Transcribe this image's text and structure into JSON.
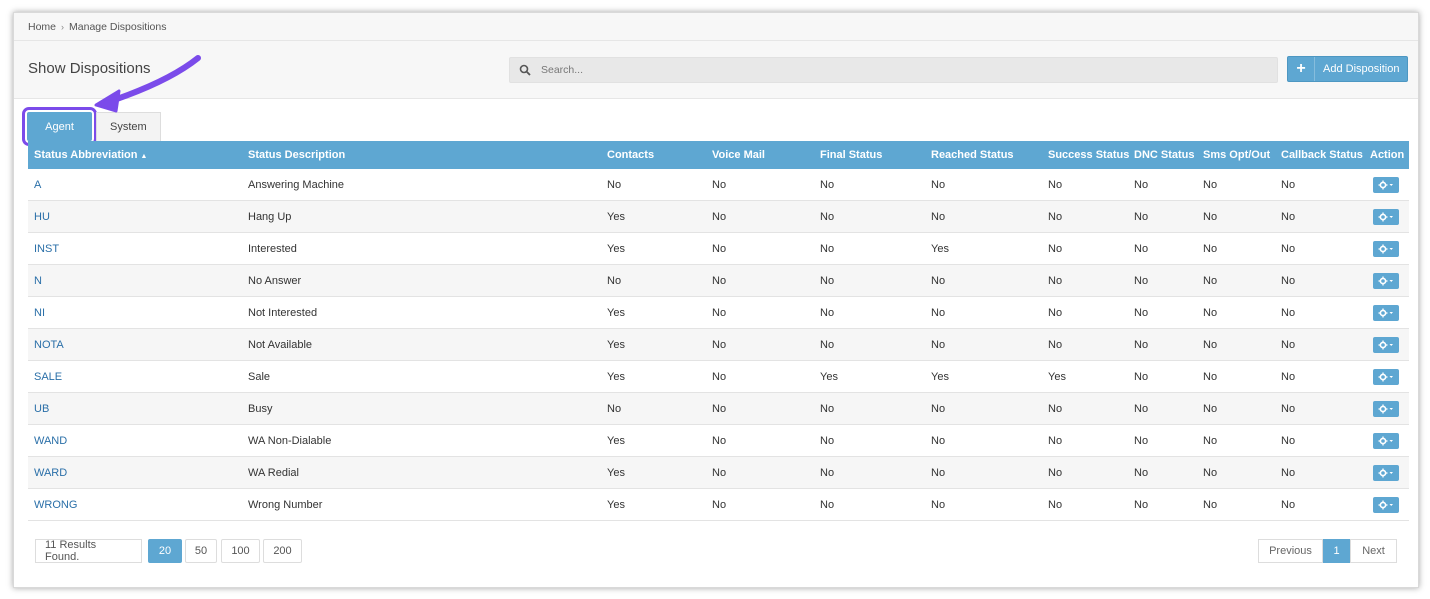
{
  "breadcrumb": {
    "home": "Home",
    "current": "Manage Dispositions"
  },
  "header": {
    "title": "Show Dispositions",
    "search_placeholder": "Search...",
    "add_button": "Add Disposition"
  },
  "tabs": [
    {
      "label": "Agent"
    },
    {
      "label": "System"
    }
  ],
  "table": {
    "headers": [
      "Status Abbreviation",
      "Status Description",
      "Contacts",
      "Voice Mail",
      "Final Status",
      "Reached Status",
      "Success Status",
      "DNC Status",
      "Sms Opt/Out",
      "Callback Status",
      "Action"
    ],
    "rows": [
      [
        "A",
        "Answering Machine",
        "No",
        "No",
        "No",
        "No",
        "No",
        "No",
        "No",
        "No"
      ],
      [
        "HU",
        "Hang Up",
        "Yes",
        "No",
        "No",
        "No",
        "No",
        "No",
        "No",
        "No"
      ],
      [
        "INST",
        "Interested",
        "Yes",
        "No",
        "No",
        "Yes",
        "No",
        "No",
        "No",
        "No"
      ],
      [
        "N",
        "No Answer",
        "No",
        "No",
        "No",
        "No",
        "No",
        "No",
        "No",
        "No"
      ],
      [
        "NI",
        "Not Interested",
        "Yes",
        "No",
        "No",
        "No",
        "No",
        "No",
        "No",
        "No"
      ],
      [
        "NOTA",
        "Not Available",
        "Yes",
        "No",
        "No",
        "No",
        "No",
        "No",
        "No",
        "No"
      ],
      [
        "SALE",
        "Sale",
        "Yes",
        "No",
        "Yes",
        "Yes",
        "Yes",
        "No",
        "No",
        "No"
      ],
      [
        "UB",
        "Busy",
        "No",
        "No",
        "No",
        "No",
        "No",
        "No",
        "No",
        "No"
      ],
      [
        "WAND",
        "WA Non-Dialable",
        "Yes",
        "No",
        "No",
        "No",
        "No",
        "No",
        "No",
        "No"
      ],
      [
        "WARD",
        "WA Redial",
        "Yes",
        "No",
        "No",
        "No",
        "No",
        "No",
        "No",
        "No"
      ],
      [
        "WRONG",
        "Wrong Number",
        "Yes",
        "No",
        "No",
        "No",
        "No",
        "No",
        "No",
        "No"
      ]
    ]
  },
  "footer": {
    "results": "11 Results Found.",
    "page_sizes": [
      "20",
      "50",
      "100",
      "200"
    ],
    "previous": "Previous",
    "page": "1",
    "next": "Next"
  },
  "colors": {
    "accent": "#5ea7d2",
    "highlight": "#7b4bea",
    "link": "#2a6fa8"
  },
  "icons": [
    "search-icon",
    "plus-icon",
    "sort-asc-icon",
    "gear-icon",
    "caret-down-icon",
    "annotation-arrow"
  ]
}
